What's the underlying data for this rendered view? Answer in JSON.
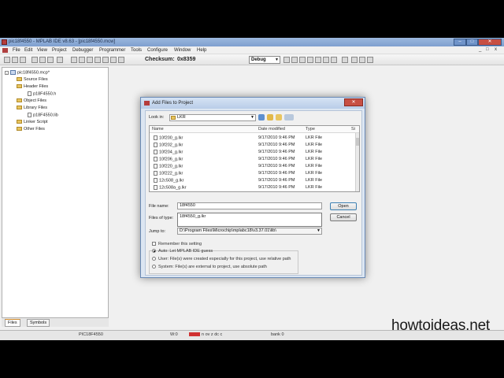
{
  "window": {
    "title": "pic18f4550 - MPLAB IDE v8.63 - [pic18f4550.mcw]",
    "controls": {
      "minimize": "–",
      "maximize": "□",
      "close": "✕"
    }
  },
  "menubar": {
    "items": [
      "File",
      "Edit",
      "View",
      "Project",
      "Debugger",
      "Programmer",
      "Tools",
      "Configure",
      "Window",
      "Help"
    ],
    "mdi_controls": [
      "_",
      "□",
      "x"
    ]
  },
  "toolbar": {
    "checksum_label": "Checksum:",
    "checksum_value": "0x8359",
    "build_config": "Debug"
  },
  "project_tree": {
    "root": "pic18f4550.mcp*",
    "items": [
      {
        "label": "Source Files",
        "type": "folder",
        "expand": "",
        "level": 1
      },
      {
        "label": "Header Files",
        "type": "folder",
        "expand": "-",
        "level": 1
      },
      {
        "label": "p18F4550.h",
        "type": "file",
        "expand": "",
        "level": 2
      },
      {
        "label": "Object Files",
        "type": "folder",
        "expand": "",
        "level": 1
      },
      {
        "label": "Library Files",
        "type": "folder",
        "expand": "-",
        "level": 1
      },
      {
        "label": "p18F4550.lib",
        "type": "file",
        "expand": "",
        "level": 2
      },
      {
        "label": "Linker Script",
        "type": "folder",
        "expand": "",
        "level": 1
      },
      {
        "label": "Other Files",
        "type": "folder",
        "expand": "",
        "level": 1
      }
    ],
    "tabs": [
      "Files",
      "Symbols"
    ]
  },
  "statusbar": {
    "device": "PIC18F4550",
    "w": "W:0",
    "flags": "n ov z dc c",
    "bank": "bank 0"
  },
  "dialog": {
    "title": "Add Files to Project",
    "close": "✕",
    "look_in_label": "Look in:",
    "look_in_value": "LKR",
    "columns": [
      "Name",
      "Date modified",
      "Type",
      "Si"
    ],
    "files": [
      {
        "name": "10f200_g.lkr",
        "date": "9/17/2010 9:46 PM",
        "type": "LKR File"
      },
      {
        "name": "10f202_g.lkr",
        "date": "9/17/2010 9:46 PM",
        "type": "LKR File"
      },
      {
        "name": "10f204_g.lkr",
        "date": "9/17/2010 9:46 PM",
        "type": "LKR File"
      },
      {
        "name": "10f206_g.lkr",
        "date": "9/17/2010 9:46 PM",
        "type": "LKR File"
      },
      {
        "name": "10f220_g.lkr",
        "date": "9/17/2010 9:46 PM",
        "type": "LKR File"
      },
      {
        "name": "10f222_g.lkr",
        "date": "9/17/2010 9:46 PM",
        "type": "LKR File"
      },
      {
        "name": "12c508_g.lkr",
        "date": "9/17/2010 9:46 PM",
        "type": "LKR File"
      },
      {
        "name": "12c508a_g.lkr",
        "date": "9/17/2010 9:46 PM",
        "type": "LKR File"
      }
    ],
    "file_name_label": "File name:",
    "file_name_value": "18f4550",
    "autocomplete": "18f4550_g.lkr",
    "files_of_type_label": "Files of type:",
    "open_button": "Open",
    "cancel_button": "Cancel",
    "jump_to_label": "Jump to:",
    "jump_to_value": "D:\\Program Files\\Microchip\\mplabc18\\v3.37.01\\lib\\",
    "remember_label": "Remember this setting",
    "radio_auto": "Auto: Let MPLAB IDE guess",
    "radio_user": "User: File(s) were created especially for this project, use relative path",
    "radio_system": "System: File(s) are external to project, use absolute path"
  },
  "watermark": "howtoideas.net"
}
